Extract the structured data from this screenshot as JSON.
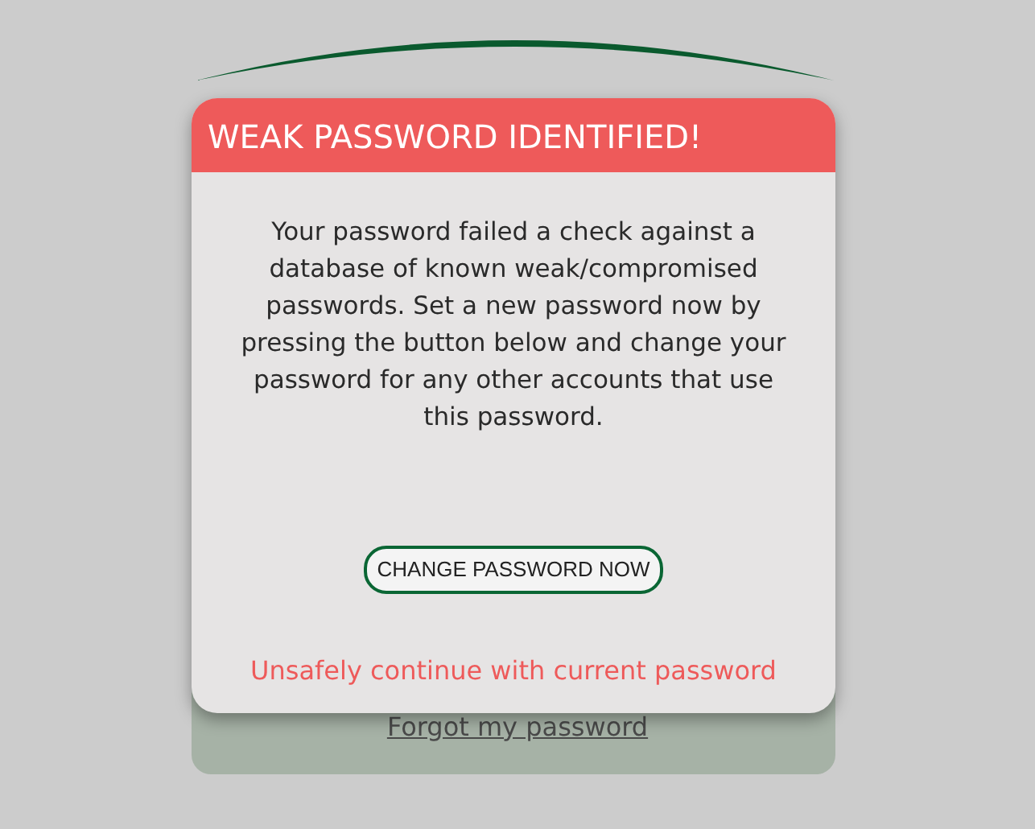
{
  "login_card": {
    "forgot_link": "Forgot my password"
  },
  "modal": {
    "title": "WEAK PASSWORD IDENTIFIED!",
    "message": "Your password failed a check against a database of known weak/compromised passwords. Set a new password now by pressing the button below and change your password for any other accounts that use this password.",
    "primary_button": "CHANGE PASSWORD NOW",
    "secondary_link": "Unsafely continue with current password"
  }
}
